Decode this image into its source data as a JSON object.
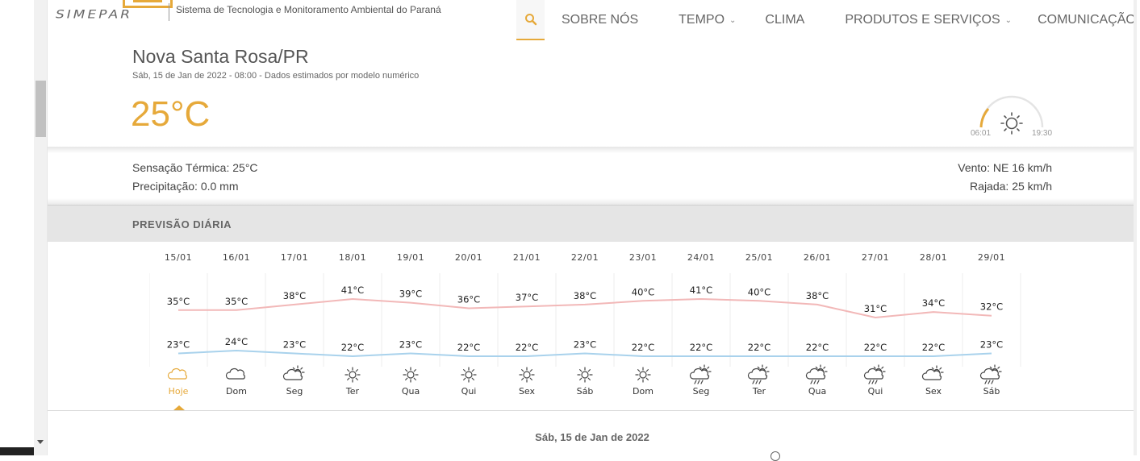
{
  "header": {
    "logo_text": "SIMEPAR",
    "tagline": "Sistema de Tecnologia e Monitoramento Ambiental do Paraná",
    "nav": [
      {
        "label": "SOBRE NÓS",
        "dropdown": false
      },
      {
        "label": "TEMPO",
        "dropdown": true
      },
      {
        "label": "CLIMA",
        "dropdown": false
      },
      {
        "label": "PRODUTOS E SERVIÇOS",
        "dropdown": true
      },
      {
        "label": "COMUNICAÇÃO",
        "dropdown": true
      }
    ]
  },
  "location": {
    "title": "Nova Santa Rosa/PR",
    "subtitle": "Sáb, 15 de Jan de 2022 - 08:00 - Dados estimados por modelo numérico",
    "temperature": "25°C",
    "sunrise": "06:01",
    "sunset": "19:30"
  },
  "details": {
    "sensacao": "Sensação Térmica: 25°C",
    "precipitacao": "Precipitação: 0.0 mm",
    "vento": "Vento: NE 16 km/h",
    "rajada": "Rajada: 25 km/h"
  },
  "forecast": {
    "section_title": "PREVISÃO DIÁRIA",
    "selected_date": "Sáb, 15 de Jan de 2022",
    "colors": {
      "accent": "#e6a93a",
      "max_line": "#f2b8b8",
      "min_line": "#a9d2ec"
    },
    "days": [
      {
        "date": "15/01",
        "max": 35,
        "min": 23,
        "label": "Hoje",
        "icon": "cloudy-icon",
        "selected": true
      },
      {
        "date": "16/01",
        "max": 35,
        "min": 24,
        "label": "Dom",
        "icon": "cloudy-icon"
      },
      {
        "date": "17/01",
        "max": 38,
        "min": 23,
        "label": "Seg",
        "icon": "partly-cloudy-icon"
      },
      {
        "date": "18/01",
        "max": 41,
        "min": 22,
        "label": "Ter",
        "icon": "sun-icon"
      },
      {
        "date": "19/01",
        "max": 39,
        "min": 23,
        "label": "Qua",
        "icon": "sun-icon"
      },
      {
        "date": "20/01",
        "max": 36,
        "min": 22,
        "label": "Qui",
        "icon": "sun-icon"
      },
      {
        "date": "21/01",
        "max": 37,
        "min": 22,
        "label": "Sex",
        "icon": "sun-icon"
      },
      {
        "date": "22/01",
        "max": 38,
        "min": 23,
        "label": "Sáb",
        "icon": "sun-icon"
      },
      {
        "date": "23/01",
        "max": 40,
        "min": 22,
        "label": "Dom",
        "icon": "sun-icon"
      },
      {
        "date": "24/01",
        "max": 41,
        "min": 22,
        "label": "Seg",
        "icon": "sun-rain-icon"
      },
      {
        "date": "25/01",
        "max": 40,
        "min": 22,
        "label": "Ter",
        "icon": "sun-rain-icon"
      },
      {
        "date": "26/01",
        "max": 38,
        "min": 22,
        "label": "Qua",
        "icon": "sun-rain-icon"
      },
      {
        "date": "27/01",
        "max": 31,
        "min": 22,
        "label": "Qui",
        "icon": "sun-rain-icon"
      },
      {
        "date": "28/01",
        "max": 34,
        "min": 22,
        "label": "Sex",
        "icon": "partly-cloudy-icon"
      },
      {
        "date": "29/01",
        "max": 32,
        "min": 23,
        "label": "Sáb",
        "icon": "sun-rain-icon"
      }
    ]
  }
}
